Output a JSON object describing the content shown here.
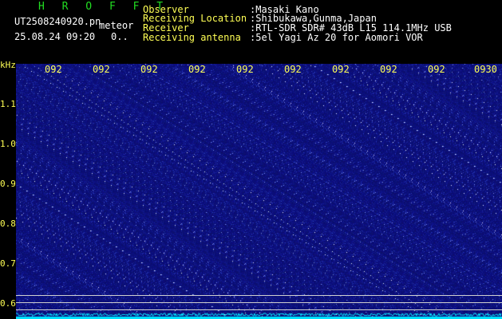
{
  "header": {
    "title": "H R O F F T",
    "filename": "UT2508240920.pn",
    "meteor": "meteor",
    "timestamp": "25.08.24 09:20",
    "count": "0..",
    "labels": [
      "Observer",
      "Receiving Location",
      "Receiver",
      "Receiving antenna"
    ],
    "values": [
      ":Masaki Kano",
      ":Shibukawa,Gunma,Japan",
      ":RTL-SDR SDR# 43dB L15 114.1MHz USB",
      ":5el Yagi Az 20 for Aomori VOR"
    ]
  },
  "axis": {
    "y_unit": "kHz",
    "x_ticks": [
      "092",
      "092",
      "092",
      "092",
      "092",
      "092",
      "092",
      "092",
      "092",
      "0930"
    ],
    "y_ticks": [
      "1.1",
      "1.0",
      "0.9",
      "0.8",
      "0.7",
      "0.6"
    ]
  },
  "colors": {
    "background": "#000000",
    "spectrogram_base": "#0a0d7a",
    "noise_trace": "#00e5ff",
    "axis_text": "#ffff55",
    "title": "#22dd22"
  }
}
